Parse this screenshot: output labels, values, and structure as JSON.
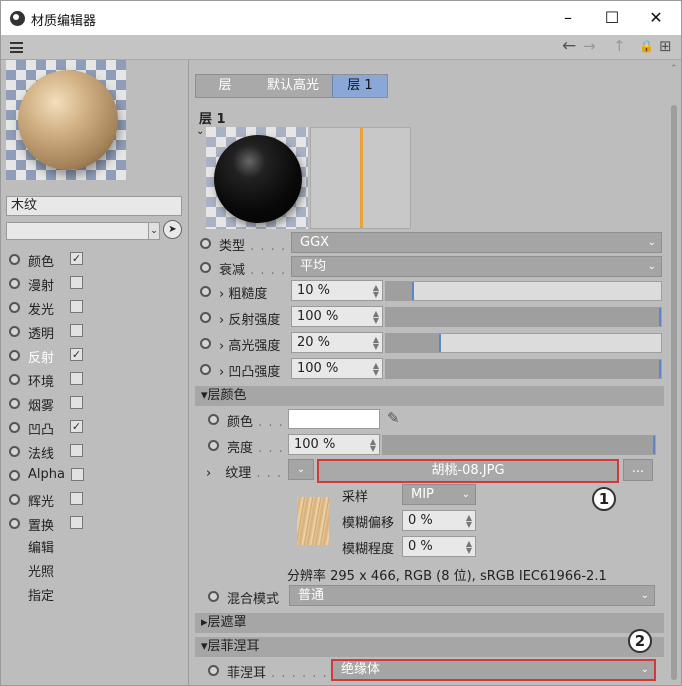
{
  "window": {
    "title": "材质编辑器",
    "minimize": "–",
    "maximize": "☐",
    "close": "✕"
  },
  "toolbar": {
    "back": "←",
    "forward": "→",
    "up": "↑",
    "lock": "🔒",
    "new": "⊞"
  },
  "left": {
    "material_name": "木纹",
    "channels": [
      {
        "label": "颜色",
        "checked": true
      },
      {
        "label": "漫射",
        "checked": false
      },
      {
        "label": "发光",
        "checked": false
      },
      {
        "label": "透明",
        "checked": false
      },
      {
        "label": "反射",
        "checked": true
      },
      {
        "label": "环境",
        "checked": false
      },
      {
        "label": "烟雾",
        "checked": false
      },
      {
        "label": "凹凸",
        "checked": true
      },
      {
        "label": "法线",
        "checked": false
      },
      {
        "label": "Alpha",
        "checked": false
      },
      {
        "label": "辉光",
        "checked": false
      },
      {
        "label": "置换",
        "checked": false
      }
    ],
    "check_mark": "✓",
    "links": [
      "编辑",
      "光照",
      "指定"
    ]
  },
  "main": {
    "tabs": [
      "层",
      "默认高光",
      "层 1"
    ],
    "active_tab": 2,
    "layer_title": "层 1",
    "type": {
      "label": "类型",
      "value": "GGX"
    },
    "attenuation": {
      "label": "衰减",
      "value": "平均"
    },
    "roughness": {
      "label": "粗糙度",
      "value": "10 %",
      "fraction": 0.1
    },
    "reflect_strength": {
      "label": "反射强度",
      "value": "100 %",
      "fraction": 1.0
    },
    "specular_strength": {
      "label": "高光强度",
      "value": "20 %",
      "fraction": 0.2
    },
    "bump_strength": {
      "label": "凹凸强度",
      "value": "100 %",
      "fraction": 1.0
    },
    "section_layer_color": "层颜色",
    "color": {
      "label": "颜色"
    },
    "brightness": {
      "label": "亮度",
      "value": "100 %",
      "fraction": 1.0
    },
    "texture": {
      "label": "纹理",
      "file": "胡桃-08.JPG",
      "more": "..."
    },
    "sampling": {
      "label": "采样",
      "value": "MIP"
    },
    "blur_offset": {
      "label": "模糊偏移",
      "value": "0 %"
    },
    "blur_amount": {
      "label": "模糊程度",
      "value": "0 %"
    },
    "resolution": "分辨率 295 x 466, RGB (8 位), sRGB IEC61966-2.1",
    "blend_mode": {
      "label": "混合模式",
      "value": "普通"
    },
    "section_layer_mask": "层遮罩",
    "section_layer_fresnel": "层菲涅耳",
    "fresnel": {
      "label": "菲涅耳",
      "value": "绝缘体"
    },
    "callout_1": "1",
    "callout_2": "2"
  }
}
